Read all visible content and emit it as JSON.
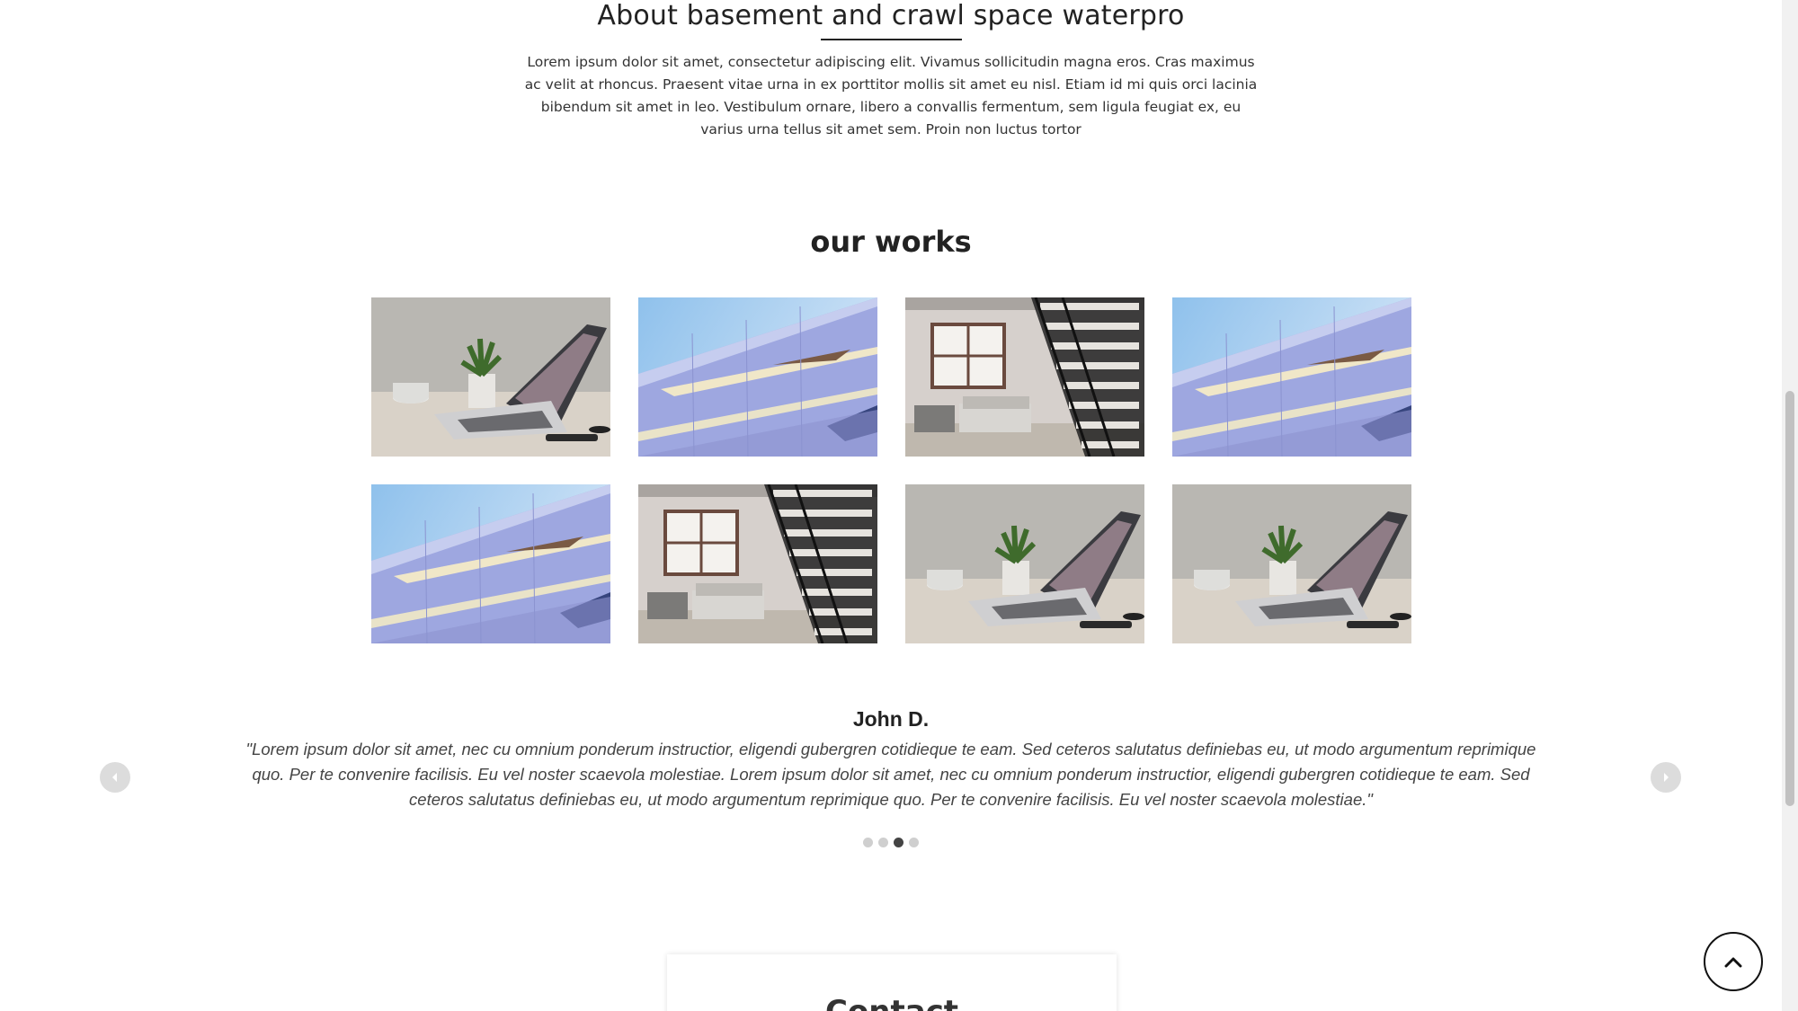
{
  "about": {
    "title": "About basement and crawl space waterpro",
    "text": "Lorem ipsum dolor sit amet, consectetur adipiscing elit. Vivamus sollicitudin magna eros. Cras maximus ac velit at rhoncus. Praesent vitae urna in ex porttitor mollis sit amet eu nisl. Etiam id mi quis orci lacinia bibendum sit amet in leo. Vestibulum ornare, libero a convallis fermentum, sem ligula feugiat ex, eu varius urna tellus sit amet sem. Proin non luctus tortor"
  },
  "works": {
    "title": "our works",
    "images": [
      {
        "kind": "laptop-desk-photo"
      },
      {
        "kind": "building-facade-photo"
      },
      {
        "kind": "loft-staircase-photo"
      },
      {
        "kind": "building-facade-photo"
      },
      {
        "kind": "building-facade-photo"
      },
      {
        "kind": "loft-staircase-photo"
      },
      {
        "kind": "laptop-desk-photo"
      },
      {
        "kind": "laptop-desk-photo"
      }
    ]
  },
  "testimonial": {
    "name": "John D.",
    "quote": "\"Lorem ipsum dolor sit amet, nec cu omnium ponderum instructior, eligendi gubergren cotidieque te eam. Sed ceteros salutatus definiebas eu, ut modo argumentum reprimique quo. Per te convenire facilisis. Eu vel noster scaevola molestiae. Lorem ipsum dolor sit amet, nec cu omnium ponderum instructior, eligendi gubergren cotidieque te eam. Sed ceteros salutatus definiebas eu, ut modo argumentum reprimique quo. Per te convenire facilisis. Eu vel noster scaevola molestiae.\"",
    "slide_count": 4,
    "active_slide": 3,
    "prev_icon": "chevron-left-icon",
    "next_icon": "chevron-right-icon"
  },
  "contact": {
    "title": "Contact"
  },
  "controls": {
    "back_to_top_icon": "chevron-up-icon"
  },
  "colors": {
    "text": "#2b2b2b",
    "arrow_bg": "#dcdcdc",
    "dot_inactive": "#cfcfcf",
    "dot_active": "#444444"
  }
}
